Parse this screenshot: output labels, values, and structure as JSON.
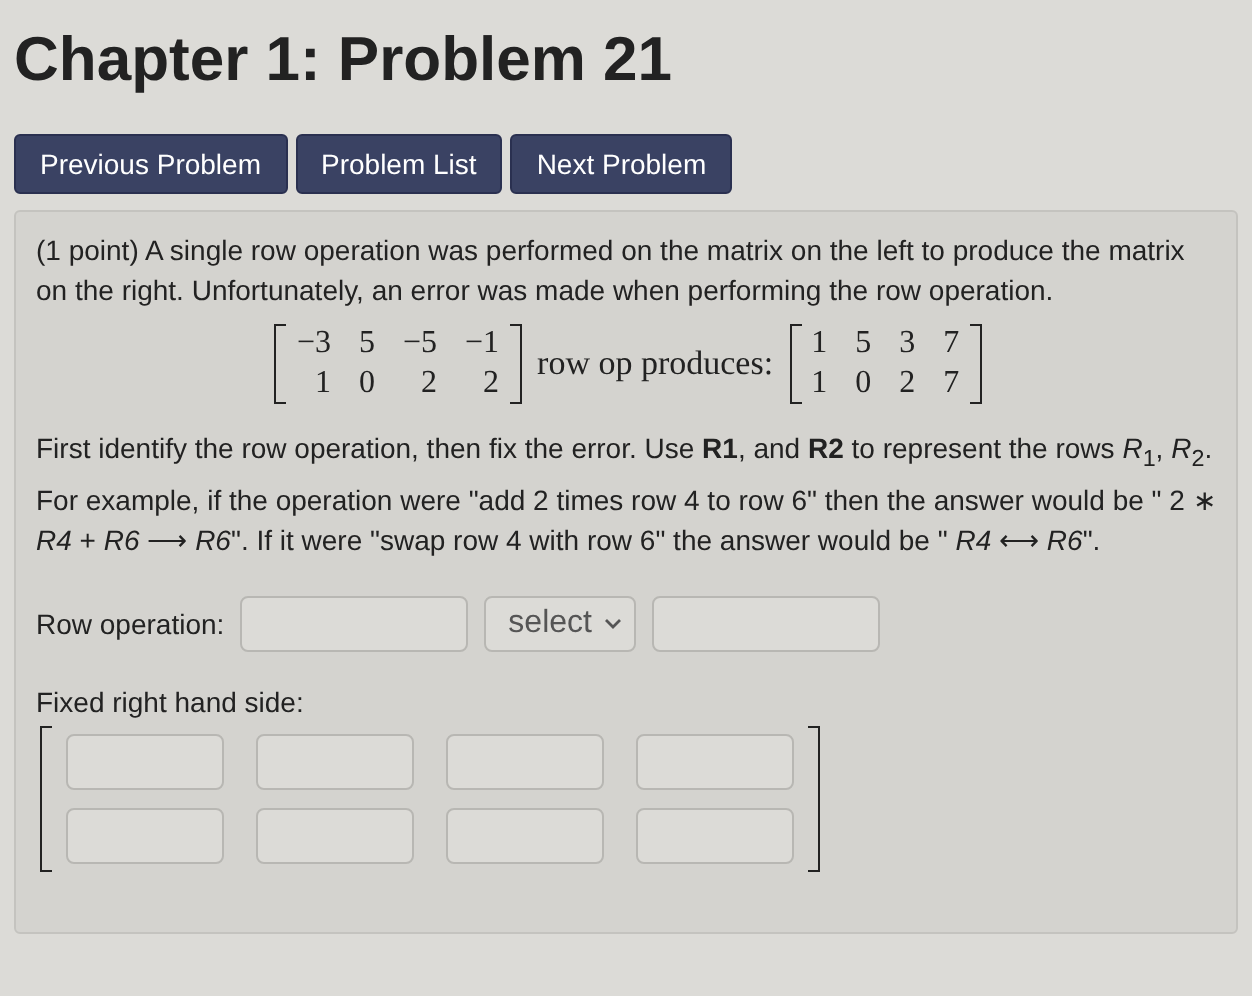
{
  "title": "Chapter 1: Problem 21",
  "nav_buttons": [
    "Previous Problem",
    "Problem List",
    "Next Problem"
  ],
  "problem": {
    "intro": "(1 point) A single row operation was performed on the matrix on the left to produce the matrix on the right. Unfortunately, an error was made when performing the row operation.",
    "left_matrix": [
      [
        "−3",
        "5",
        "−5",
        "−1"
      ],
      [
        "1",
        "0",
        "2",
        "2"
      ]
    ],
    "between": "row op produces:",
    "right_matrix": [
      [
        "1",
        "5",
        "3",
        "7"
      ],
      [
        "1",
        "0",
        "2",
        "7"
      ]
    ],
    "instructions": "First identify the row operation, then fix the error. Use **R1**, and **R2** to represent the rows *R*$_{1}$, *R*$_{2}$. For example, if the operation were \"add 2 times row 4 to row 6\" then the answer would be \" 2 ∗ *R4* + *R6* ⟶ *R6*\". If it were \"swap row 4 with row 6\" the answer would be \" *R4* ⟷ *R6*\".",
    "row_operation": {
      "label": "Row operation:",
      "fields": [
        {
          "kind": "input"
        },
        {
          "kind": "select",
          "value": "select"
        },
        {
          "kind": "input"
        }
      ]
    },
    "fixed": {
      "label": "Fixed right hand side:",
      "rows": [
        {
          "cells": [
            {
              "kind": "input"
            },
            {
              "kind": "input"
            },
            {
              "kind": "input"
            },
            {
              "kind": "input"
            }
          ]
        },
        {
          "cells": [
            {
              "kind": "input"
            },
            {
              "kind": "input"
            },
            {
              "kind": "input"
            },
            {
              "kind": "input"
            }
          ]
        }
      ]
    }
  }
}
